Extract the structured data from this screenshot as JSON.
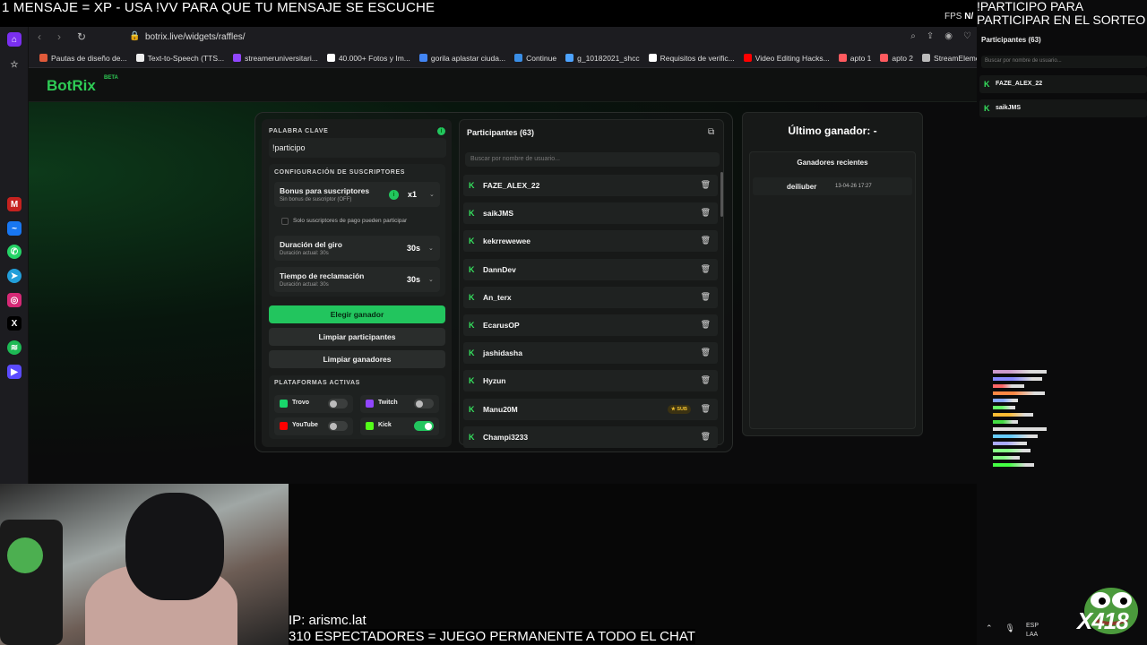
{
  "overlay": {
    "top_message": "1 MENSAJE = XP - USA !VV PARA QUE TU MENSAJE SE ESCUCHE",
    "fps_label": "FPS",
    "fps_value": "N/",
    "right_message": "!PARTICIPO PARA PARTICIPAR EN EL SORTEO"
  },
  "browser": {
    "url": "botrix.live/widgets/raffles/",
    "bookmarks": [
      {
        "label": "Pautas de diseño de...",
        "color": "#e05a3a"
      },
      {
        "label": "Text-to-Speech (TTS...",
        "color": "#eeeeee"
      },
      {
        "label": "streameruniversitari...",
        "color": "#9146ff"
      },
      {
        "label": "40.000+ Fotos y Im...",
        "color": "#ffffff"
      },
      {
        "label": "gorila aplastar ciuda...",
        "color": "#4285f4"
      },
      {
        "label": "Continue",
        "color": "#3a8ee6"
      },
      {
        "label": "g_10182021_shcc",
        "color": "#4da3ff"
      },
      {
        "label": "Requisitos de verific...",
        "color": "#ffffff"
      },
      {
        "label": "Video Editing Hacks...",
        "color": "#ff0000"
      },
      {
        "label": "apto 1",
        "color": "#ff5a5f"
      },
      {
        "label": "apto 2",
        "color": "#ff5a5f"
      },
      {
        "label": "StreamElements - st...",
        "color": "#bbbbbb"
      }
    ]
  },
  "app": {
    "logo": "BotRix",
    "logo_badge": "BETA"
  },
  "config": {
    "keyword_label": "PALABRA CLAVE",
    "keyword_value": "!participo",
    "subs_section_label": "CONFIGURACIÓN DE SUSCRIPTORES",
    "bonus_title": "Bonus para suscriptores",
    "bonus_sub": "Sin bonus de suscriptor (OFF)",
    "bonus_value": "x1",
    "only_paid_label": "Solo suscriptores de pago pueden participar",
    "spin_title": "Duración del giro",
    "spin_sub": "Duración actual: 30s",
    "spin_value": "30s",
    "claim_title": "Tiempo de reclamación",
    "claim_sub": "Duración actual: 30s",
    "claim_value": "30s",
    "btn_pick": "Elegir ganador",
    "btn_clear_participants": "Limpiar participantes",
    "btn_clear_winners": "Limpiar ganadores",
    "platforms_label": "PLATAFORMAS ACTIVAS",
    "platforms": [
      {
        "name": "Trovo",
        "enabled": false,
        "color": "#19d66b"
      },
      {
        "name": "Twitch",
        "enabled": false,
        "color": "#9146ff"
      },
      {
        "name": "YouTube",
        "enabled": false,
        "color": "#ff0000"
      },
      {
        "name": "Kick",
        "enabled": true,
        "color": "#53fc18"
      }
    ]
  },
  "participants": {
    "title": "Participantes (63)",
    "search_placeholder": "Buscar por nombre de usuario...",
    "sub_badge": "SUB",
    "items": [
      "FAZE_ALEX_22",
      "saikJMS",
      "kekrrewewee",
      "DannDev",
      "An_terx",
      "EcarusOP",
      "jashidasha",
      "Hyzun",
      "Manu20M",
      "Champi3233"
    ]
  },
  "winner": {
    "title": "Último ganador: -",
    "recent_title": "Ganadores recientes",
    "recent": [
      {
        "name": "deiliuber",
        "date": "13-04-26 17:27"
      }
    ]
  },
  "right_panel": {
    "title": "Participantes (63)",
    "search_placeholder": "Buscar por nombre de usuario...",
    "items": [
      "FAZE_ALEX_22",
      "saikJMS"
    ]
  },
  "stream": {
    "ip_text": "IP: arismc.lat",
    "viewers_text": "310 ESPECTADORES = JUEGO PERMANENTE A TODO EL CHAT",
    "brand_text": "X418",
    "lang_line1": "ESP",
    "lang_line2": "LAA"
  }
}
